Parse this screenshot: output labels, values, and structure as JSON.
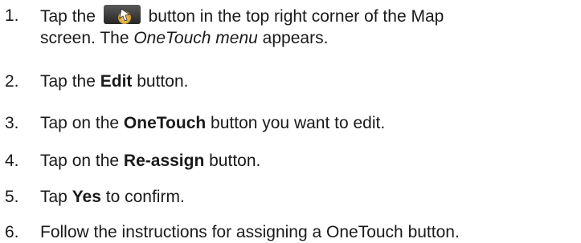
{
  "steps": [
    {
      "number": "1.",
      "line1_before": "Tap the",
      "line1_after": "button in the top right corner of the Map",
      "line2_before": "screen. The ",
      "line2_italic": "OneTouch menu",
      "line2_after": " appears.",
      "icon": "onetouch-menu-icon"
    },
    {
      "number": "2.",
      "before": "Tap the ",
      "bold": "Edit",
      "after": " button."
    },
    {
      "number": "3.",
      "before": "Tap on the ",
      "bold": "OneTouch",
      "after": " button you want to edit."
    },
    {
      "number": "4.",
      "before": "Tap on the ",
      "bold": "Re-assign",
      "after": " button."
    },
    {
      "number": "5.",
      "before": "Tap ",
      "bold": "Yes",
      "after": " to confirm."
    },
    {
      "number": "6.",
      "text": "Follow the instructions for assigning a OneTouch button."
    }
  ],
  "colors": {
    "text": "#1a1a1a",
    "icon_background": "#3a3a3a",
    "icon_accent": "#e8b83a"
  }
}
